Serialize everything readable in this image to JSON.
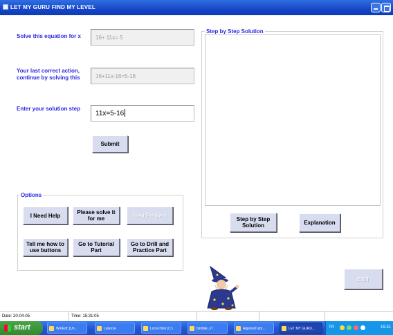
{
  "window": {
    "title": "LET MY GURU FIND MY LEVEL"
  },
  "form": {
    "equation_label": "Solve this equation for x",
    "equation_value": "16+ 11x= 5",
    "last_action_label": "Your last correct action, continue by solving this",
    "last_action_value": "16+11x-16=5-16",
    "solution_step_label": "Enter your solution step",
    "solution_step_value": "11x=5-16",
    "submit_label": "Submit"
  },
  "options": {
    "group_label": "Options",
    "need_help": "I Need Help",
    "please_solve": "Please solve it for me",
    "next_problem": "Next Problem",
    "tell_me_buttons": "Tell me how to use buttons",
    "go_to_tutorial": "Go to Tutorial Part",
    "go_to_drill": "Go to Drill and Practice Part"
  },
  "solution_panel": {
    "group_label": "Step by Step Solution",
    "step_by_step_button": "Step by Step Solution",
    "explanation_button": "Explanation"
  },
  "exit_label": "EXIT",
  "status": {
    "date": "Date: 20-04-05",
    "time": "Time: 15:31:05"
  },
  "taskbar": {
    "start": "start",
    "tasks": [
      "WinEdt: [Un...",
      "Latex2e",
      "Local Disk (C:)",
      "bimbile_v7",
      "AlgebraTutor...",
      "LET MY GURU..."
    ],
    "tray_lang": "TR",
    "clock": "15:31"
  },
  "colors": {
    "label_blue": "#2a2ae0",
    "button_face": "#d8dcef",
    "titlebar_blue": "#1747c8"
  }
}
